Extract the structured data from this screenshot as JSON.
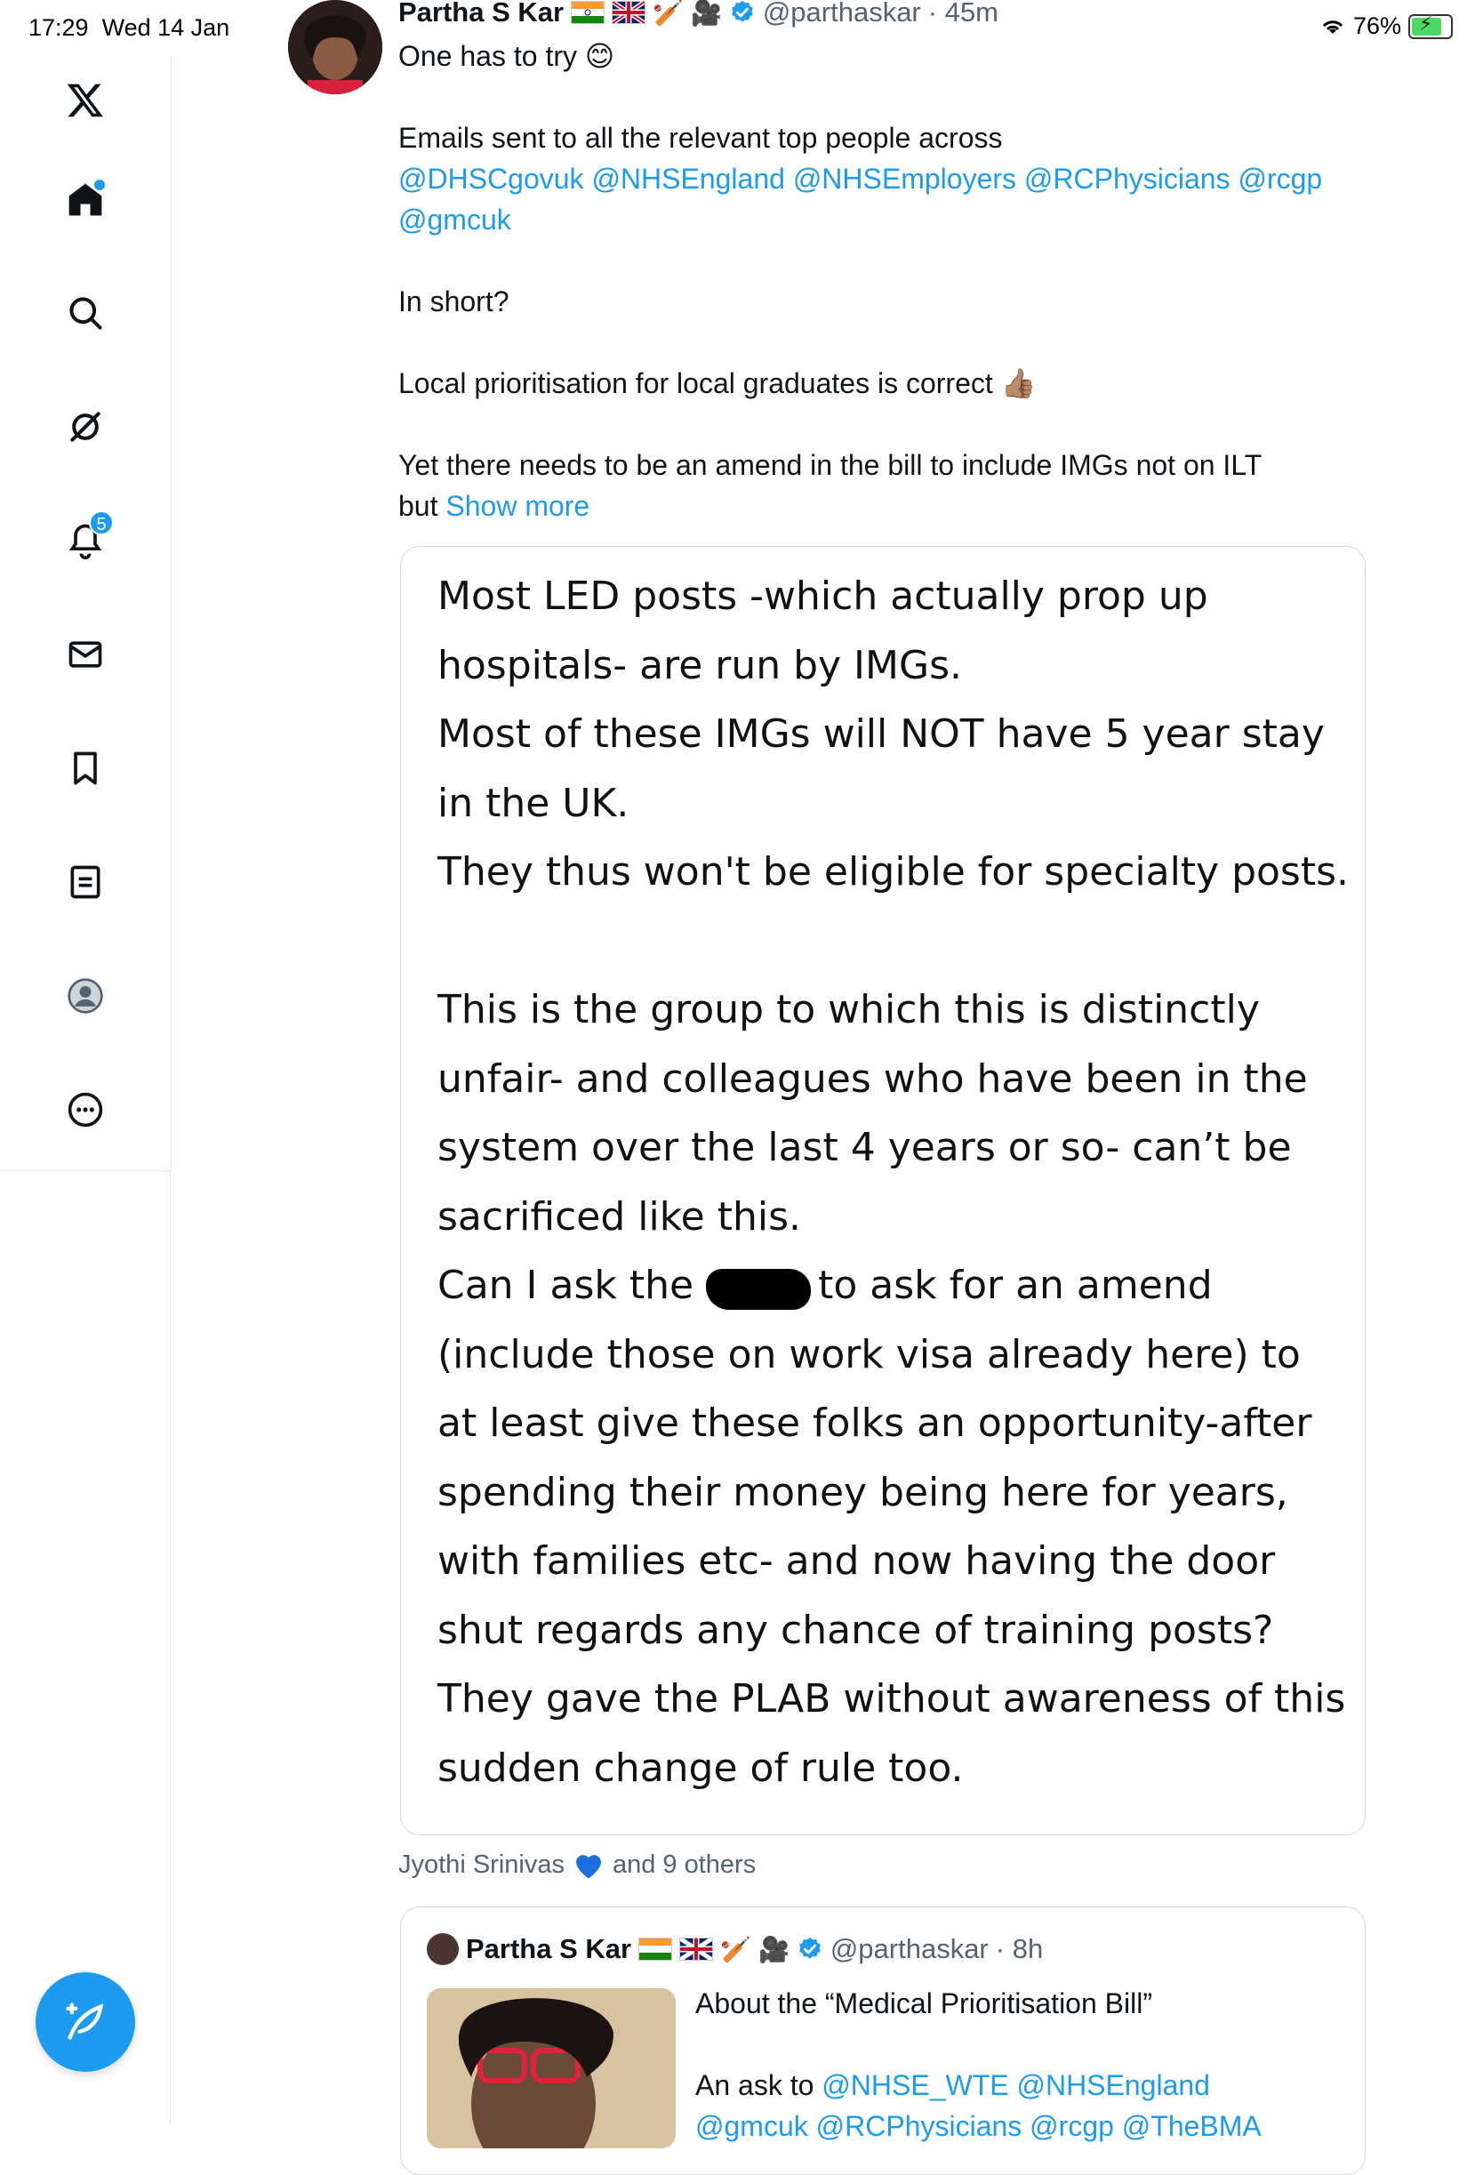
{
  "status_bar": {
    "time": "17:29",
    "date": "Wed 14 Jan",
    "battery": "76%"
  },
  "sidebar": {
    "items": [
      {
        "name": "logo",
        "icon": "x-logo-icon"
      },
      {
        "name": "home",
        "icon": "home-icon"
      },
      {
        "name": "search",
        "icon": "search-icon"
      },
      {
        "name": "grok",
        "icon": "grok-icon"
      },
      {
        "name": "notifications",
        "icon": "bell-icon",
        "badge": "5"
      },
      {
        "name": "messages",
        "icon": "mail-icon"
      },
      {
        "name": "bookmarks",
        "icon": "bookmark-icon"
      },
      {
        "name": "lists",
        "icon": "list-icon"
      },
      {
        "name": "profile",
        "icon": "profile-icon"
      },
      {
        "name": "more",
        "icon": "more-icon"
      }
    ],
    "compose_icon": "compose-icon"
  },
  "tweet": {
    "author": "Partha S Kar",
    "handle": "@parthaskar",
    "time": "· 45m",
    "line1": "One has to try 😊",
    "emails_intro": "Emails sent to all the relevant top people across",
    "mentions": [
      "@DHSCgovuk",
      "@NHSEngland",
      "@NHSEmployers",
      "@RCPhysicians",
      "@rcgp",
      "@gmcuk"
    ],
    "in_short": "In short?",
    "local": "Local prioritisation for local graduates is correct 👍🏽",
    "yet_line": "Yet there needs to be an amend in the bill to include IMGs not on ILT",
    "but": "but",
    "show_more": "Show more"
  },
  "image_text": {
    "lines": [
      "Most LED posts -which actually prop up",
      "hospitals- are run by IMGs.",
      "Most of these IMGs will NOT have 5 year stay",
      "in the UK.",
      "They thus won't be eligible for specialty posts.",
      "",
      "This is the group to which this is distinctly",
      "unfair- and colleagues who have been in the",
      "system over the last 4 years or so- can’t be",
      "sacrificed like this."
    ],
    "redact_prefix": "Can I ask the ",
    "redact_suffix": "to ask for an amend",
    "lines2": [
      "(include those on work visa already here) to",
      "at least give these folks an opportunity-after",
      "spending their money being here for years,",
      "with families etc- and now having the door",
      "shut regards any chance of training posts?",
      "They gave the PLAB without awareness of this",
      "sudden change of rule too."
    ]
  },
  "likers": {
    "name": "Jyothi Srinivas",
    "others": "and 9 others"
  },
  "quote": {
    "author": "Partha S Kar",
    "handle": "@parthaskar",
    "time": "· 8h",
    "line1": "About the “Medical Prioritisation Bill”",
    "line2_prefix": "An ask to",
    "mentions": [
      "@NHSE_WTE",
      "@NHSEngland"
    ],
    "line3": "@gmcuk @RCPhysicians @rcgp @TheBMA"
  },
  "colors": {
    "accent": "#1d9bf0",
    "secondary_text": "#536471",
    "border": "#cfd9de"
  }
}
